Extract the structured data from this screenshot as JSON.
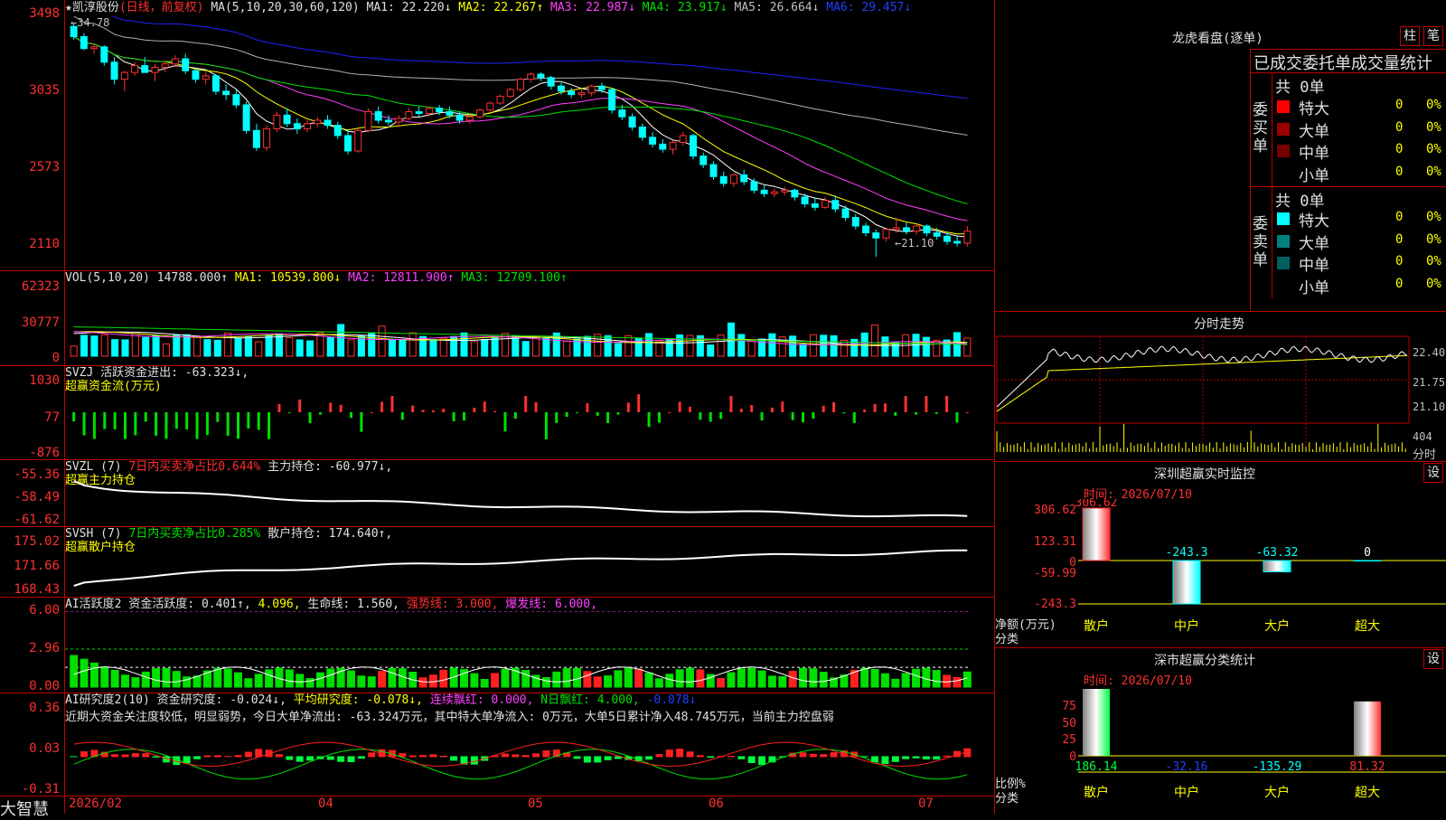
{
  "header": {
    "star": "★",
    "stock_name": "凯淳股份",
    "period": "(日线，前复权)",
    "ma_label": "MA(5,10,20,30,60,120)",
    "ma1": "MA1: 22.220↓",
    "ma2": "MA2: 22.267↑",
    "ma3": "MA3: 22.987↓",
    "ma4": "MA4: 23.917↓",
    "ma5": "MA5: 26.664↓",
    "ma6": "MA6: 29.457↓"
  },
  "price_axis": [
    "3498",
    "3035",
    "2573",
    "2110"
  ],
  "price_annotations": {
    "high": "34.78",
    "low": "21.10"
  },
  "vol_panel": {
    "axis": [
      "62323",
      "30777",
      "0"
    ],
    "label": "VOL(5,10,20)",
    "value": "14788.000↑",
    "ma1": "MA1: 10539.800↓",
    "ma2": "MA2: 12811.900↑",
    "ma3": "MA3: 12709.100↑"
  },
  "svzj_panel": {
    "axis": [
      "1030",
      "77",
      "-876"
    ],
    "label": "SVZJ",
    "desc": "活跃资金进出: -63.323↓,",
    "subtitle": "超赢资金流(万元)"
  },
  "svzl_panel": {
    "axis": [
      "-55.36",
      "-58.49",
      "-61.62"
    ],
    "label": "SVZL (7)",
    "ratio": "7日内买卖净占比0.644%",
    "hold": "主力持仓: -60.977↓,",
    "subtitle": "超赢主力持仓"
  },
  "svsh_panel": {
    "axis": [
      "175.02",
      "171.66",
      "168.43"
    ],
    "label": "SVSH (7)",
    "ratio": "7日内买卖净占比0.285%",
    "hold": "散户持仓: 174.640↑,",
    "subtitle": "超赢散户持仓"
  },
  "ai_active_panel": {
    "axis": [
      "6.00",
      "2.96",
      "0.00"
    ],
    "label": "AI活跃度2",
    "active": "资金活跃度: 0.401↑,",
    "val2": "4.096,",
    "life": "生命线: 1.560,",
    "strong": "强势线: 3.000,",
    "burst": "爆发线: 6.000,"
  },
  "ai_research_panel": {
    "axis": [
      "0.36",
      "0.03",
      "-0.31"
    ],
    "label": "AI研究度2(10)",
    "research": "资金研究度: -0.024↓,",
    "avg": "平均研究度: -0.078↓,",
    "red": "连续飘红: 0.000,",
    "nred": "N日飘红: 4.000,",
    "extra": "-0.078↓",
    "comment": "近期大资金关注度较低，明显弱势，今日大单净流出: -63.324万元，其中特大单净流入: 0万元，大单5日累计净入48.745万元，当前主力控盘弱"
  },
  "date_axis": [
    "2026/02",
    "04",
    "05",
    "06",
    "07"
  ],
  "app_name": "大智慧",
  "side": {
    "lhb_title": "龙虎看盘(逐单)",
    "btn_bar": "柱",
    "btn_pen": "笔",
    "entrust_title": "已成交委托单成交量统计",
    "buy_label": "委买单",
    "sell_label": "委卖单",
    "buy_total": "共 0单",
    "sell_total": "共 0单",
    "categories": [
      "特大",
      "大单",
      "中单",
      "小单"
    ],
    "buy_values": [
      "0",
      "0",
      "0",
      "0"
    ],
    "sell_values": [
      "0",
      "0",
      "0",
      "0"
    ],
    "buy_pct": [
      "0%",
      "0%",
      "0%",
      "0%"
    ],
    "sell_pct": [
      "0%",
      "0%",
      "0%",
      "0%"
    ],
    "buy_colors": [
      "#ff0000",
      "#990000",
      "#770000",
      "#000000"
    ],
    "sell_colors": [
      "#00ffff",
      "#008080",
      "#006060",
      "#000000"
    ],
    "intraday_title": "分时走势",
    "intraday_axis": [
      "22.40",
      "21.75",
      "21.10"
    ],
    "intraday_vol": "404",
    "intraday_tag": "分时",
    "monitor_title": "深圳超赢实时监控",
    "monitor_btn": "设",
    "monitor_time": "时间: 2026/07/10",
    "monitor_axis": [
      "306.62",
      "123.31",
      "0",
      "-59.99",
      "-243.3"
    ],
    "monitor_unit": "净额(万元)",
    "monitor_cat": "分类",
    "monitor_cats": [
      "散户",
      "中户",
      "大户",
      "超大"
    ],
    "monitor_values": [
      "306.62",
      "-243.3",
      "-63.32",
      "0"
    ],
    "stat_title": "深市超赢分类统计",
    "stat_btn": "设",
    "stat_time": "时间: 2026/07/10",
    "stat_axis": [
      "75",
      "50",
      "25",
      "0"
    ],
    "stat_unit": "比例%",
    "stat_cat": "分类",
    "stat_cats": [
      "散户",
      "中户",
      "大户",
      "超大"
    ],
    "stat_values": [
      "186.14",
      "-32.16",
      "-135.29",
      "81.32"
    ]
  },
  "chart_data": [
    {
      "type": "candlestick",
      "title": "凯淳股份",
      "x_range": [
        "2026/02",
        "2026/07"
      ],
      "ylim": [
        21.1,
        34.98
      ],
      "y_ticks": [
        34.98,
        30.35,
        25.73,
        21.1
      ],
      "annotations": [
        {
          "label": "34.78",
          "kind": "high"
        },
        {
          "label": "21.10",
          "kind": "low"
        }
      ],
      "series": [
        {
          "name": "MA1",
          "last": 22.22
        },
        {
          "name": "MA2",
          "last": 22.267
        },
        {
          "name": "MA3",
          "last": 22.987
        },
        {
          "name": "MA4",
          "last": 23.917
        },
        {
          "name": "MA5",
          "last": 26.664
        },
        {
          "name": "MA6",
          "last": 29.457
        }
      ],
      "ohlc": [
        [
          34.6,
          34.78,
          33.8,
          34.0
        ],
        [
          34.0,
          34.2,
          33.2,
          33.3
        ],
        [
          33.3,
          33.6,
          33.0,
          33.4
        ],
        [
          33.4,
          33.5,
          32.3,
          32.5
        ],
        [
          32.5,
          32.8,
          31.2,
          31.5
        ],
        [
          31.5,
          32.0,
          30.8,
          31.9
        ],
        [
          31.9,
          32.5,
          31.7,
          32.3
        ],
        [
          32.3,
          32.8,
          32.0,
          31.9
        ],
        [
          31.9,
          32.4,
          31.4,
          32.2
        ],
        [
          32.2,
          32.6,
          31.9,
          32.4
        ],
        [
          32.4,
          32.9,
          32.2,
          32.7
        ],
        [
          32.7,
          33.0,
          31.8,
          32.0
        ],
        [
          32.0,
          32.2,
          31.3,
          31.5
        ],
        [
          31.5,
          31.9,
          31.2,
          31.7
        ],
        [
          31.7,
          31.8,
          30.6,
          30.8
        ],
        [
          30.8,
          31.2,
          30.3,
          30.6
        ],
        [
          30.6,
          30.9,
          29.8,
          30.0
        ],
        [
          30.0,
          30.2,
          28.3,
          28.5
        ],
        [
          28.5,
          28.9,
          27.3,
          27.5
        ],
        [
          27.5,
          28.8,
          27.3,
          28.6
        ],
        [
          28.6,
          29.6,
          28.4,
          29.4
        ],
        [
          29.4,
          29.8,
          28.7,
          28.9
        ],
        [
          28.9,
          29.2,
          28.3,
          28.6
        ],
        [
          28.6,
          29.1,
          28.4,
          28.9
        ],
        [
          28.9,
          29.3,
          28.7,
          29.1
        ],
        [
          29.1,
          29.4,
          28.6,
          28.8
        ],
        [
          28.8,
          29.0,
          28.0,
          28.2
        ],
        [
          28.2,
          28.5,
          27.1,
          27.3
        ],
        [
          27.3,
          28.6,
          27.2,
          28.5
        ],
        [
          28.5,
          29.8,
          28.4,
          29.6
        ],
        [
          29.6,
          29.9,
          28.9,
          29.1
        ],
        [
          29.1,
          29.4,
          28.8,
          29.0
        ],
        [
          29.0,
          29.4,
          28.7,
          29.2
        ],
        [
          29.2,
          29.8,
          29.1,
          29.6
        ],
        [
          29.6,
          29.9,
          29.3,
          29.5
        ],
        [
          29.5,
          29.9,
          29.4,
          29.8
        ],
        [
          29.8,
          30.0,
          29.4,
          29.6
        ],
        [
          29.6,
          29.9,
          29.2,
          29.4
        ],
        [
          29.4,
          29.6,
          28.9,
          29.1
        ],
        [
          29.1,
          29.5,
          28.9,
          29.3
        ],
        [
          29.3,
          29.8,
          29.2,
          29.7
        ],
        [
          29.7,
          30.2,
          29.6,
          30.1
        ],
        [
          30.1,
          30.6,
          30.0,
          30.5
        ],
        [
          30.5,
          31.0,
          30.4,
          30.9
        ],
        [
          30.9,
          31.6,
          30.8,
          31.5
        ],
        [
          31.5,
          31.9,
          31.3,
          31.8
        ],
        [
          31.8,
          31.9,
          31.4,
          31.6
        ],
        [
          31.6,
          31.7,
          30.9,
          31.1
        ],
        [
          31.1,
          31.3,
          30.6,
          30.8
        ],
        [
          30.8,
          31.0,
          30.4,
          30.6
        ],
        [
          30.6,
          30.9,
          30.4,
          30.7
        ],
        [
          30.7,
          31.2,
          30.5,
          31.1
        ],
        [
          31.1,
          31.3,
          30.7,
          30.9
        ],
        [
          30.9,
          31.0,
          29.5,
          29.7
        ],
        [
          29.7,
          30.0,
          29.1,
          29.3
        ],
        [
          29.3,
          29.5,
          28.5,
          28.7
        ],
        [
          28.7,
          28.9,
          27.9,
          28.1
        ],
        [
          28.1,
          28.4,
          27.5,
          27.7
        ],
        [
          27.7,
          28.0,
          27.2,
          27.4
        ],
        [
          27.4,
          27.9,
          27.1,
          27.8
        ],
        [
          27.8,
          28.4,
          27.6,
          28.2
        ],
        [
          28.2,
          28.3,
          26.8,
          27.0
        ],
        [
          27.0,
          27.2,
          26.3,
          26.5
        ],
        [
          26.5,
          26.7,
          25.6,
          25.8
        ],
        [
          25.8,
          26.1,
          25.2,
          25.4
        ],
        [
          25.4,
          26.0,
          25.2,
          25.9
        ],
        [
          25.9,
          26.2,
          25.3,
          25.5
        ],
        [
          25.5,
          25.7,
          24.8,
          25.0
        ],
        [
          25.0,
          25.3,
          24.6,
          24.8
        ],
        [
          24.8,
          25.1,
          24.6,
          24.9
        ],
        [
          24.9,
          25.2,
          24.7,
          25.0
        ],
        [
          25.0,
          25.1,
          24.4,
          24.6
        ],
        [
          24.6,
          24.8,
          24.0,
          24.2
        ],
        [
          24.2,
          24.5,
          23.8,
          24.0
        ],
        [
          24.0,
          24.6,
          23.9,
          24.4
        ],
        [
          24.4,
          24.7,
          23.7,
          23.9
        ],
        [
          23.9,
          24.1,
          23.2,
          23.4
        ],
        [
          23.4,
          23.6,
          22.7,
          22.9
        ],
        [
          22.9,
          23.1,
          22.3,
          22.5
        ],
        [
          22.5,
          22.7,
          21.1,
          22.2
        ],
        [
          22.2,
          22.8,
          22.0,
          22.7
        ],
        [
          22.7,
          23.4,
          22.5,
          22.8
        ],
        [
          22.8,
          23.1,
          22.4,
          22.6
        ],
        [
          22.6,
          23.0,
          22.4,
          22.9
        ],
        [
          22.9,
          23.0,
          22.3,
          22.5
        ],
        [
          22.5,
          22.8,
          22.1,
          22.3
        ],
        [
          22.3,
          22.5,
          21.8,
          22.0
        ],
        [
          22.0,
          22.3,
          21.7,
          21.9
        ],
        [
          21.9,
          22.9,
          21.7,
          22.6
        ]
      ]
    },
    {
      "type": "bar",
      "title": "VOL(5,10,20)",
      "ylim": [
        0,
        62323
      ],
      "series": [
        {
          "name": "MA1",
          "last": 10539.8
        },
        {
          "name": "MA2",
          "last": 12811.9
        },
        {
          "name": "MA3",
          "last": 12709.1
        }
      ],
      "last_value": 14788.0
    },
    {
      "type": "bar",
      "title": "SVZJ",
      "ylim": [
        -876,
        1030
      ],
      "last_value": -63.323
    },
    {
      "type": "line",
      "title": "SVZL (7)",
      "ylim": [
        -61.62,
        -55.36
      ],
      "last_value": -60.977
    },
    {
      "type": "line",
      "title": "SVSH (7)",
      "ylim": [
        168.43,
        175.02
      ],
      "last_value": 174.64
    },
    {
      "type": "bar",
      "title": "AI活跃度2",
      "ylim": [
        0,
        6.0
      ],
      "last_value": 0.401
    },
    {
      "type": "bar",
      "title": "AI研究度2(10)",
      "ylim": [
        -0.31,
        0.36
      ],
      "last_value": -0.024
    },
    {
      "type": "bar",
      "title": "深圳超赢实时监控",
      "categories": [
        "散户",
        "中户",
        "大户",
        "超大"
      ],
      "values": [
        306.62,
        -243.3,
        -63.32,
        0
      ],
      "ylim": [
        -243.3,
        306.62
      ],
      "ylabel": "净额(万元)"
    },
    {
      "type": "bar",
      "title": "深市超赢分类统计",
      "categories": [
        "散户",
        "中户",
        "大户",
        "超大"
      ],
      "values": [
        186.14,
        -32.16,
        -135.29,
        81.32
      ],
      "ylim": [
        0,
        75
      ],
      "ylabel": "比例%"
    }
  ]
}
